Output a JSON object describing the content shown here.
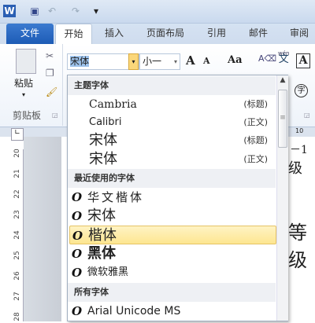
{
  "quick_access": {
    "word_icon": "W",
    "save": "save-icon",
    "undo": "undo-icon",
    "redo": "redo-icon",
    "customize": "▾"
  },
  "tabs": [
    {
      "label": "文件"
    },
    {
      "label": "开始"
    },
    {
      "label": "插入"
    },
    {
      "label": "页面布局"
    },
    {
      "label": "引用"
    },
    {
      "label": "邮件"
    },
    {
      "label": "审阅"
    }
  ],
  "clipboard": {
    "paste": "粘贴",
    "group": "剪贴板"
  },
  "font": {
    "name": "宋体",
    "size": "小一",
    "grow": "A",
    "shrink": "A",
    "case": "Aa",
    "phonetic": "wén",
    "phonetic_char": "文",
    "border_char": "A",
    "enclose": "字"
  },
  "ruler": {
    "h_mark": "10",
    "v_marks": [
      "20",
      "21",
      "22",
      "23",
      "24",
      "25",
      "26",
      "27",
      "28"
    ]
  },
  "doc": {
    "line1": "－1",
    "line2": "级",
    "line3": "等级"
  },
  "dropdown": {
    "theme_header": "主题字体",
    "theme": [
      {
        "name": "Cambria",
        "tag": "(标题)"
      },
      {
        "name": "Calibri",
        "tag": "(正文)"
      },
      {
        "name": "宋体",
        "tag": "(标题)"
      },
      {
        "name": "宋体",
        "tag": "(正文)"
      }
    ],
    "recent_header": "最近使用的字体",
    "recent": [
      {
        "name": "华文楷体"
      },
      {
        "name": "宋体"
      },
      {
        "name": "楷体",
        "selected": true
      },
      {
        "name": "黑体"
      },
      {
        "name": "微软雅黑"
      }
    ],
    "all_header": "所有字体",
    "all": [
      {
        "name": "Arial Unicode MS"
      }
    ],
    "font_type_icon": "O"
  },
  "colors": {
    "accent": "#1d5bb5",
    "highlight": "#fde690"
  }
}
